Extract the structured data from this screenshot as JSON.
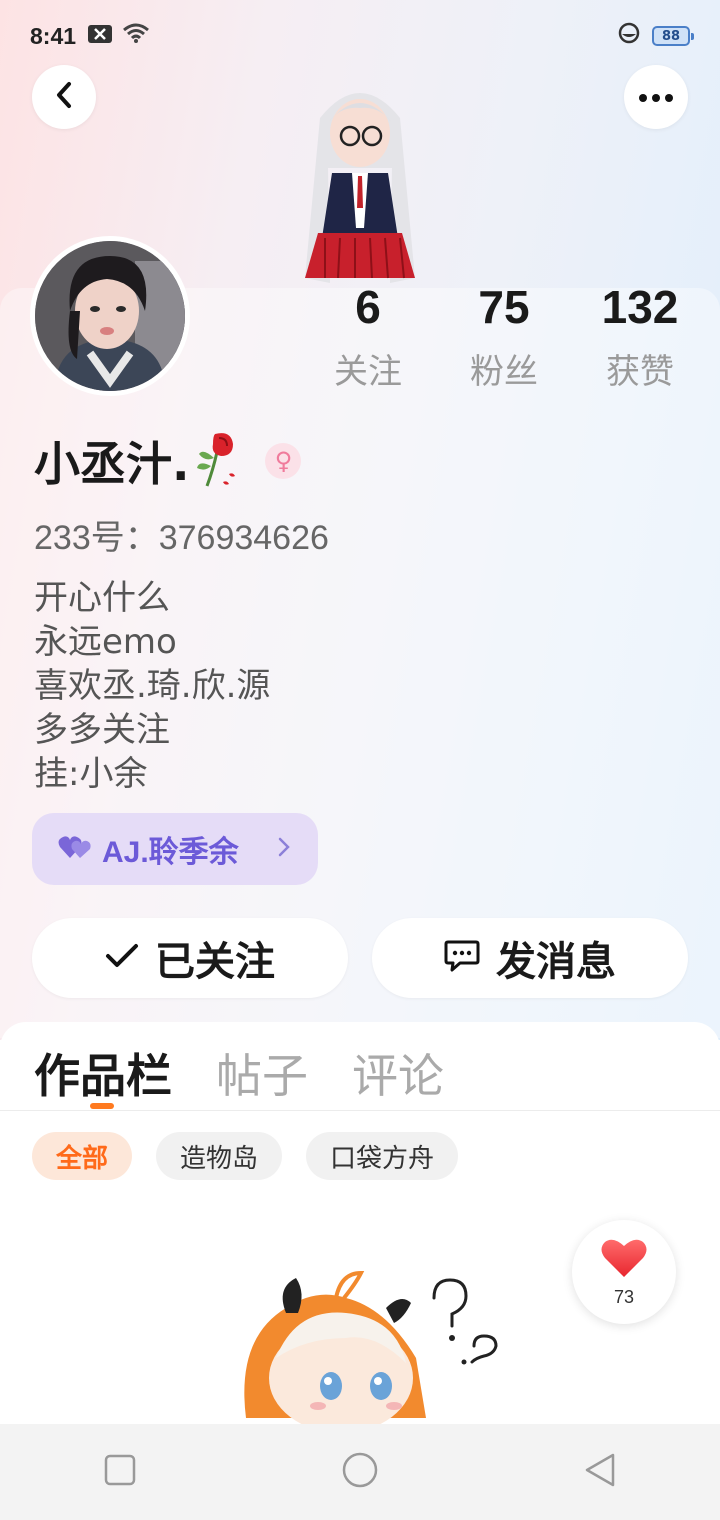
{
  "status_bar": {
    "time": "8:41",
    "battery": "88"
  },
  "profile": {
    "stats": [
      {
        "value": "6",
        "label": "关注"
      },
      {
        "value": "75",
        "label": "粉丝"
      },
      {
        "value": "132",
        "label": "获赞"
      }
    ],
    "username": "小丞汁.",
    "gender_symbol": "♀",
    "user_id": "233号：376934626",
    "bio_lines": [
      "开心什么",
      "永远emo",
      "喜欢丞.琦.欣.源",
      "多多关注",
      "挂:小余"
    ],
    "friend_tag": "AJ.聆季余"
  },
  "actions": {
    "follow_label": "已关注",
    "message_label": "发消息"
  },
  "tabs": [
    "作品栏",
    "帖子",
    "评论"
  ],
  "filters": [
    "全部",
    "造物岛",
    "口袋方舟"
  ],
  "like_count": "73",
  "colors": {
    "accent": "#ff7a1f",
    "tag_purple": "#6c5ad8",
    "gender_pink": "#f07b9c"
  }
}
